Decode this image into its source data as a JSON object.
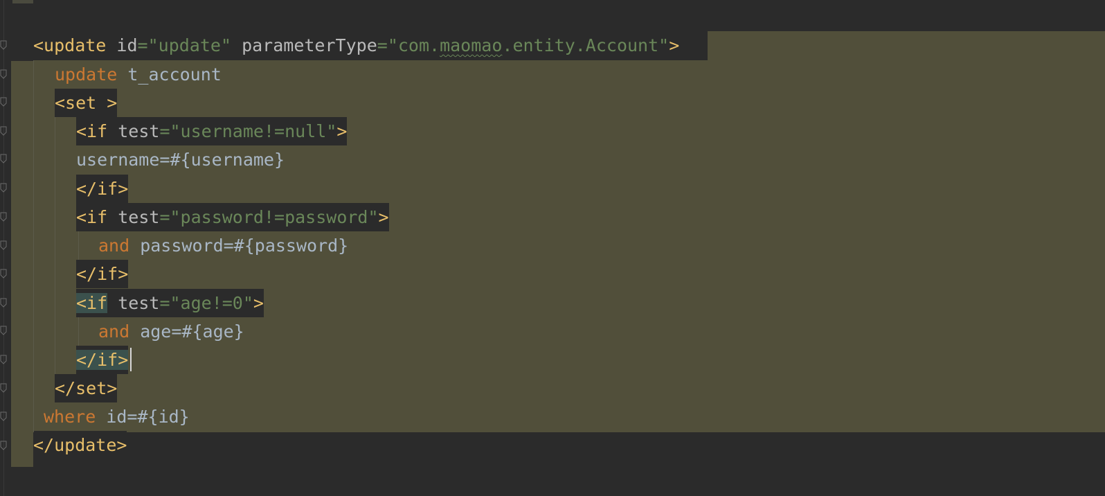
{
  "editor": {
    "lines": [
      [
        {
          "t": "<update",
          "c": "tag"
        },
        {
          "t": " ",
          "c": "txt"
        },
        {
          "t": "id",
          "c": "attr"
        },
        {
          "t": "=",
          "c": "str"
        },
        {
          "t": "\"update\"",
          "c": "str"
        },
        {
          "t": " ",
          "c": "txt"
        },
        {
          "t": "parameterType",
          "c": "attr"
        },
        {
          "t": "=",
          "c": "str"
        },
        {
          "t": "\"com.",
          "c": "str"
        },
        {
          "t": "maomao",
          "c": "str wavy"
        },
        {
          "t": ".entity.Account\"",
          "c": "str"
        },
        {
          "t": ">",
          "c": "tag"
        }
      ],
      [
        {
          "t": "update",
          "c": "kw"
        },
        {
          "t": " t_account",
          "c": "txt"
        }
      ],
      [
        {
          "t": "<set >",
          "c": "tag"
        }
      ],
      [
        {
          "t": "<if",
          "c": "tag"
        },
        {
          "t": " ",
          "c": "txt"
        },
        {
          "t": "test",
          "c": "attr"
        },
        {
          "t": "=",
          "c": "str"
        },
        {
          "t": "\"username!=null\"",
          "c": "str"
        },
        {
          "t": ">",
          "c": "tag"
        }
      ],
      [
        {
          "t": "username=#{username}",
          "c": "txt"
        }
      ],
      [
        {
          "t": "</if>",
          "c": "tag"
        }
      ],
      [
        {
          "t": "<if",
          "c": "tag"
        },
        {
          "t": " ",
          "c": "txt"
        },
        {
          "t": "test",
          "c": "attr"
        },
        {
          "t": "=",
          "c": "str"
        },
        {
          "t": "\"password!=password\"",
          "c": "str"
        },
        {
          "t": ">",
          "c": "tag"
        }
      ],
      [
        {
          "t": "and",
          "c": "kw"
        },
        {
          "t": " password=#{password}",
          "c": "txt"
        }
      ],
      [
        {
          "t": "</if>",
          "c": "tag"
        }
      ],
      [
        {
          "t": "<if",
          "c": "tag match"
        },
        {
          "t": " ",
          "c": "txt"
        },
        {
          "t": "test",
          "c": "attr"
        },
        {
          "t": "=",
          "c": "str"
        },
        {
          "t": "\"age!=0\"",
          "c": "str"
        },
        {
          "t": ">",
          "c": "tag"
        }
      ],
      [
        {
          "t": "and",
          "c": "kw"
        },
        {
          "t": " age=#{age}",
          "c": "txt"
        }
      ],
      [
        {
          "t": "</if>",
          "c": "tag match"
        }
      ],
      [
        {
          "t": "</set>",
          "c": "tag"
        }
      ],
      [
        {
          "t": "where",
          "c": "kw"
        },
        {
          "t": " id=#{id}",
          "c": "txt"
        }
      ],
      [
        {
          "t": "</update>",
          "c": "tag"
        }
      ]
    ]
  }
}
